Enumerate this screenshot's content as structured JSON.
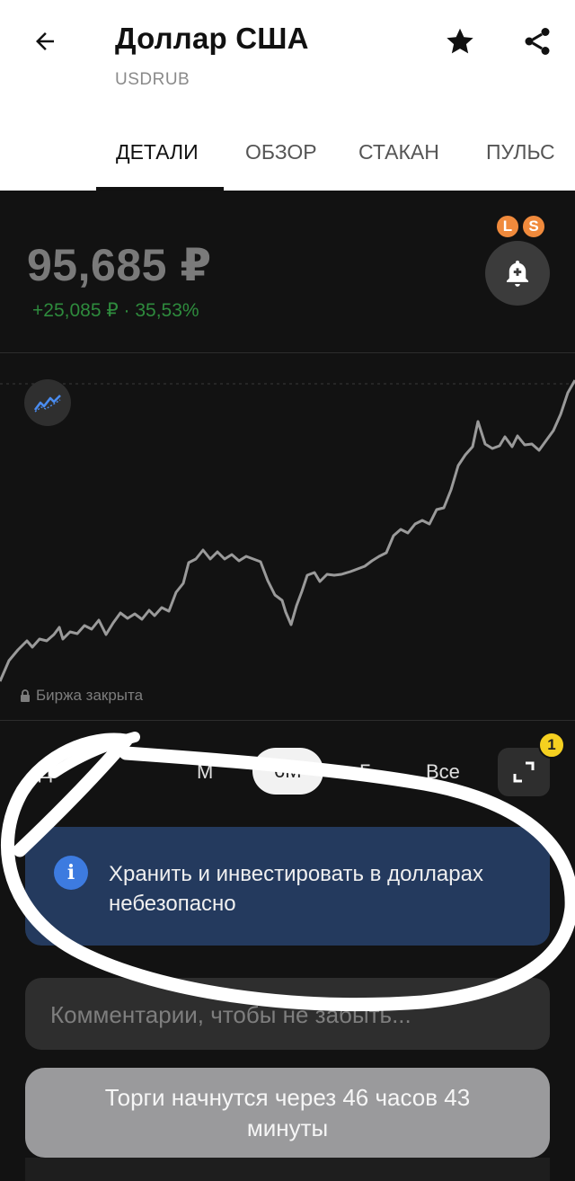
{
  "header": {
    "title": "Доллар США",
    "ticker": "USDRUB",
    "back_icon": "arrow-left-icon",
    "favorite_icon": "star-icon",
    "share_icon": "share-icon"
  },
  "tabs": [
    {
      "label": "ДЕТАЛИ",
      "active": true
    },
    {
      "label": "ОБЗОР",
      "active": false
    },
    {
      "label": "СТАКАН",
      "active": false
    },
    {
      "label": "ПУЛЬС",
      "active": false
    }
  ],
  "quote": {
    "price": "95,685 ₽",
    "change": "+25,085 ₽ · 35,53%",
    "badges": [
      "L",
      "S"
    ],
    "alert_icon": "bell-plus-icon"
  },
  "chart": {
    "type_icon": "line-chart-icon",
    "status": "Биржа закрыта",
    "line_color": "#9a9a9a"
  },
  "periods": [
    {
      "label": "Д",
      "active": false
    },
    {
      "label": "М",
      "active": false
    },
    {
      "label": "6М",
      "active": true
    },
    {
      "label": "Г",
      "active": false
    },
    {
      "label": "Все",
      "active": false
    }
  ],
  "expand": {
    "icon": "expand-icon",
    "badge": "1"
  },
  "info": {
    "icon": "info-icon",
    "text": "Хранить и инвестировать в долларах небезопасно"
  },
  "comment": {
    "placeholder": "Комментарии, чтобы не забыть..."
  },
  "trade_status": "Торги начнутся через 46 часов 43 минуты",
  "colors": {
    "background": "#121212",
    "info_card": "#243a5e",
    "positive": "#2e8b3d",
    "badge_orange": "#f08a3c",
    "badge_yellow": "#f5d020"
  }
}
